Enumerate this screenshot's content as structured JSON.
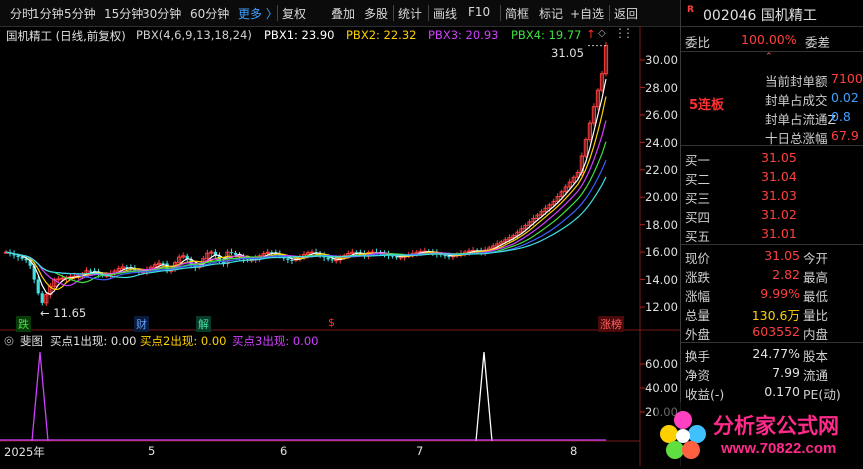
{
  "toolbar": {
    "items": [
      "分时",
      "1分钟",
      "5分钟",
      "15分钟",
      "30分钟",
      "60分钟",
      "更多 〉",
      "复权",
      "叠加",
      "多股",
      "统计",
      "画线",
      "F10",
      "简框",
      "标记",
      "+自选",
      "返回"
    ]
  },
  "legend": {
    "stock": "国机精工 (日线,前复权)",
    "indicator": "PBX(4,6,9,13,18,24)",
    "pbx1": "PBX1: 23.90",
    "pbx2": "PBX2: 22.32",
    "pbx3": "PBX3: 20.93",
    "pbx4": "PBX4: 19.77",
    "up_arrow": "↑"
  },
  "price_axis": [
    "30.00",
    "28.00",
    "26.00",
    "24.00",
    "22.00",
    "20.00",
    "18.00",
    "16.00",
    "14.00",
    "12.00"
  ],
  "sub_axis": [
    "60.00",
    "40.00",
    "20.00"
  ],
  "annotations": {
    "high": "31.05",
    "low": "← 11.65",
    "die": "跌",
    "cai": "财",
    "jie": "解",
    "dollar": "$",
    "zhangbang": "涨榜"
  },
  "sub_legend": {
    "name": "斐图",
    "b1": "买点1出现: 0.00",
    "b2": "买点2出现: 0.00",
    "b3": "买点3出现: 0.00"
  },
  "x_axis": [
    "2025年",
    "5",
    "6",
    "7",
    "8"
  ],
  "side": {
    "code_name": "002046 国机精工",
    "r_badge": "R",
    "weibi_label": "委比",
    "weibi_val": "100.00%",
    "weicha_label": "委差",
    "lianban": "5连板",
    "seal_rows": [
      {
        "label": "当前封单额",
        "val": "7100"
      },
      {
        "label": "封单占成交",
        "val": "0.02"
      },
      {
        "label": "封单占流通Z",
        "val": "0.8"
      },
      {
        "label": "十日总涨幅",
        "val": "67.9"
      }
    ],
    "buys": [
      {
        "label": "买一",
        "val": "31.05"
      },
      {
        "label": "买二",
        "val": "31.04"
      },
      {
        "label": "买三",
        "val": "31.03"
      },
      {
        "label": "买四",
        "val": "31.02"
      },
      {
        "label": "买五",
        "val": "31.01"
      }
    ],
    "quotes": [
      {
        "l1": "现价",
        "v": "31.05",
        "l2": "今开",
        "color": "#ff4040"
      },
      {
        "l1": "涨跌",
        "v": "2.82",
        "l2": "最高",
        "color": "#ff4040"
      },
      {
        "l1": "涨幅",
        "v": "9.99%",
        "l2": "最低",
        "color": "#ff4040"
      },
      {
        "l1": "总量",
        "v": "130.6万",
        "l2": "量比",
        "color": "#ffd000"
      },
      {
        "l1": "外盘",
        "v": "603552",
        "l2": "内盘",
        "color": "#ff4040"
      }
    ],
    "stats": [
      {
        "l1": "换手",
        "v": "24.77%",
        "l2": "股本"
      },
      {
        "l1": "净资",
        "v": "7.99",
        "l2": "流通"
      },
      {
        "l1": "收益(-)",
        "v": "0.170",
        "l2": "PE(动)"
      }
    ]
  },
  "watermark": {
    "text": "分析家公式网",
    "url": "www.70822.com"
  },
  "chart_data": {
    "type": "candlestick",
    "y_range": [
      11,
      31.5
    ],
    "candles_summary": {
      "start_low": 11.65,
      "end_high": 31.05
    },
    "series": [
      {
        "name": "PBX1",
        "last": 23.9,
        "color": "#ffffff"
      },
      {
        "name": "PBX2",
        "last": 22.32,
        "color": "#ffd000"
      },
      {
        "name": "PBX3",
        "last": 20.93,
        "color": "#d040ff"
      },
      {
        "name": "PBX4",
        "last": 19.77,
        "color": "#40e040"
      }
    ]
  },
  "colors": {
    "up": "#ff4040",
    "down": "#40e0e0",
    "pbx1": "#ffffff",
    "pbx2": "#ffd000",
    "pbx3": "#d040ff",
    "pbx4": "#40e040",
    "pbx5": "#4060ff",
    "pbx6": "#40e0e0"
  }
}
